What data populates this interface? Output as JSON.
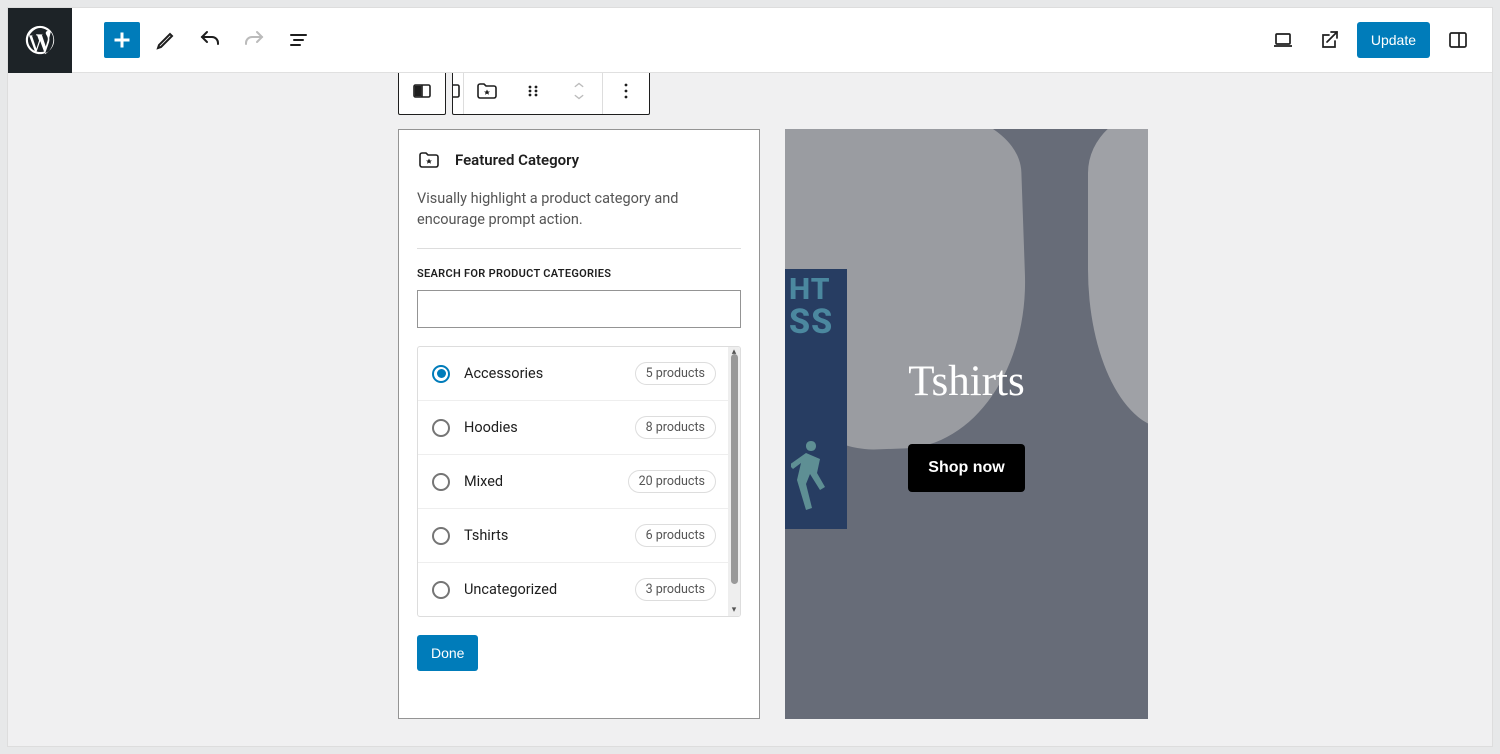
{
  "header": {
    "update_label": "Update"
  },
  "panel": {
    "title": "Featured Category",
    "description": "Visually highlight a product category and encourage prompt action.",
    "search_label": "SEARCH FOR PRODUCT CATEGORIES",
    "search_value": "",
    "done_label": "Done"
  },
  "categories": [
    {
      "name": "Accessories",
      "count_label": "5 products",
      "selected": true
    },
    {
      "name": "Hoodies",
      "count_label": "8 products",
      "selected": false
    },
    {
      "name": "Mixed",
      "count_label": "20 products",
      "selected": false
    },
    {
      "name": "Tshirts",
      "count_label": "6 products",
      "selected": false
    },
    {
      "name": "Uncategorized",
      "count_label": "3 products",
      "selected": false
    }
  ],
  "promo": {
    "title": "Tshirts",
    "button_label": "Shop now",
    "graphic_line1": "HT",
    "graphic_line2": "SS"
  }
}
